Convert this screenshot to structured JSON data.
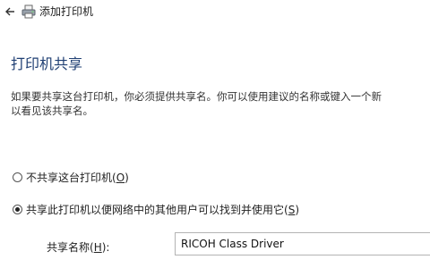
{
  "window": {
    "title": "添加打印机",
    "back_icon": "back-arrow-icon",
    "app_icon": "printer-icon"
  },
  "page": {
    "heading": "打印机共享",
    "description_line1": "如果要共享这台打印机，你必须提供共享名。你可以使用建议的名称或键入一个新",
    "description_line2": "以看见该共享名。"
  },
  "options": [
    {
      "label": "不共享这台打印机(",
      "key": "O",
      "suffix": ")",
      "selected": false
    },
    {
      "label": "共享此打印机以便网络中的其他用户可以找到并使用它(",
      "key": "S",
      "suffix": ")",
      "selected": true
    }
  ],
  "share_field": {
    "label": "共享名称(",
    "key": "H",
    "label_suffix": "):",
    "value": "RICOH Class Driver"
  },
  "colors": {
    "heading": "#1f3f73",
    "text": "#222222"
  }
}
